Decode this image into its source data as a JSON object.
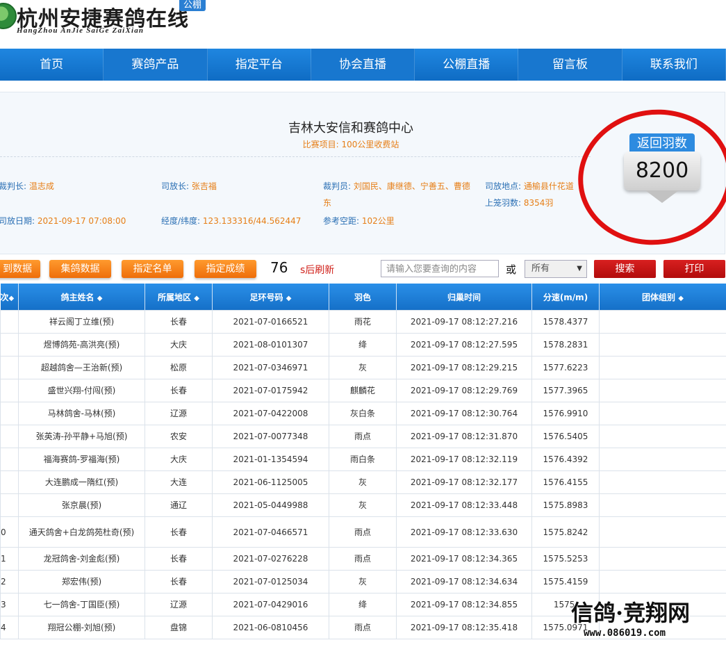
{
  "header": {
    "title": "杭州安捷赛鸽在线",
    "pinyin": "HangZhou AnJie SaiGe ZaiXian",
    "badge": "公棚"
  },
  "nav": [
    "首页",
    "赛鸽产品",
    "指定平台",
    "协会直播",
    "公棚直播",
    "留言板",
    "联系我们"
  ],
  "race": {
    "title": "吉林大安信和赛鸽中心",
    "project_label": "比赛项目:",
    "project_value": "100公里收费站",
    "chief_judge_label": "裁判长:",
    "chief_judge": "温志成",
    "release_leader_label": "司放长:",
    "release_leader": "张吉福",
    "judges_label": "裁判员:",
    "judges": "刘国民、康继德、宁善五、曹德",
    "judges_cont": "东",
    "release_place_label": "司放地点:",
    "release_place": "通榆县什花道",
    "release_date_label": "司放日期:",
    "release_date": "2021-09-17 07:08:00",
    "coords_label": "经度/纬度:",
    "coords": "123.133316/44.562447",
    "distance_label": "参考空距:",
    "distance": "102公里",
    "basketed_label": "上笼羽数:",
    "basketed": "8354羽"
  },
  "returned": {
    "label": "返回羽数",
    "value": "8200"
  },
  "toolbar": {
    "btn_arrival": "到数据",
    "btn_collect": "集鸽数据",
    "btn_named": "指定名单",
    "btn_results": "指定成绩",
    "countdown": "76",
    "countdown_label": "s后刷新",
    "search_placeholder": "请输入您要查询的内容",
    "or": "或",
    "select_value": "所有",
    "search_btn": "搜索",
    "print_btn": "打印"
  },
  "table": {
    "headers": [
      "次",
      "鸽主姓名",
      "所属地区",
      "足环号码",
      "羽色",
      "归巢时间",
      "分速(m/m)",
      "团体组别"
    ],
    "rows": [
      {
        "idx": "",
        "owner": "祥云阁丁立维(预)",
        "region": "长春",
        "ring": "2021-07-0166521",
        "color": "雨花",
        "time": "2021-09-17 08:12:27.216",
        "speed": "1578.4377",
        "group": ""
      },
      {
        "idx": "",
        "owner": "煜博鸽苑-高洪亮(预)",
        "region": "大庆",
        "ring": "2021-08-0101307",
        "color": "绛",
        "time": "2021-09-17 08:12:27.595",
        "speed": "1578.2831",
        "group": ""
      },
      {
        "idx": "",
        "owner": "超越鸽舍—王治新(预)",
        "region": "松原",
        "ring": "2021-07-0346971",
        "color": "灰",
        "time": "2021-09-17 08:12:29.215",
        "speed": "1577.6223",
        "group": ""
      },
      {
        "idx": "",
        "owner": "盛世兴翔-付闯(预)",
        "region": "长春",
        "ring": "2021-07-0175942",
        "color": "麒麟花",
        "time": "2021-09-17 08:12:29.769",
        "speed": "1577.3965",
        "group": ""
      },
      {
        "idx": "",
        "owner": "马林鸽舍-马林(预)",
        "region": "辽源",
        "ring": "2021-07-0422008",
        "color": "灰白条",
        "time": "2021-09-17 08:12:30.764",
        "speed": "1576.9910",
        "group": ""
      },
      {
        "idx": "",
        "owner": "张英涛-孙平静+马旭(预)",
        "region": "农安",
        "ring": "2021-07-0077348",
        "color": "雨点",
        "time": "2021-09-17 08:12:31.870",
        "speed": "1576.5405",
        "group": ""
      },
      {
        "idx": "",
        "owner": "福海赛鸽-罗福海(预)",
        "region": "大庆",
        "ring": "2021-01-1354594",
        "color": "雨白条",
        "time": "2021-09-17 08:12:32.119",
        "speed": "1576.4392",
        "group": ""
      },
      {
        "idx": "",
        "owner": "大连鹏成一隋红(预)",
        "region": "大连",
        "ring": "2021-06-1125005",
        "color": "灰",
        "time": "2021-09-17 08:12:32.177",
        "speed": "1576.4155",
        "group": ""
      },
      {
        "idx": "",
        "owner": "张京晨(预)",
        "region": "通辽",
        "ring": "2021-05-0449988",
        "color": "灰",
        "time": "2021-09-17 08:12:33.448",
        "speed": "1575.8983",
        "group": ""
      },
      {
        "idx": "0",
        "owner": "通天鸽舍+白龙鸽苑杜奇(预)",
        "region": "长春",
        "ring": "2021-07-0466571",
        "color": "雨点",
        "time": "2021-09-17 08:12:33.630",
        "speed": "1575.8242",
        "group": ""
      },
      {
        "idx": "1",
        "owner": "龙冠鸽舍-刘金彪(预)",
        "region": "长春",
        "ring": "2021-07-0276228",
        "color": "雨点",
        "time": "2021-09-17 08:12:34.365",
        "speed": "1575.5253",
        "group": ""
      },
      {
        "idx": "2",
        "owner": "郑宏伟(预)",
        "region": "长春",
        "ring": "2021-07-0125034",
        "color": "灰",
        "time": "2021-09-17 08:12:34.634",
        "speed": "1575.4159",
        "group": ""
      },
      {
        "idx": "3",
        "owner": "七一鸽舍-丁国臣(预)",
        "region": "辽源",
        "ring": "2021-07-0429016",
        "color": "绛",
        "time": "2021-09-17 08:12:34.855",
        "speed": "1575.",
        "group": ""
      },
      {
        "idx": "4",
        "owner": "翔冠公棚-刘旭(预)",
        "region": "盘锦",
        "ring": "2021-06-0810456",
        "color": "雨点",
        "time": "2021-09-17 08:12:35.418",
        "speed": "1575.0971",
        "group": ""
      }
    ]
  },
  "watermark": {
    "title": "信鸽·竞翔网",
    "url": "www.086019.com"
  }
}
